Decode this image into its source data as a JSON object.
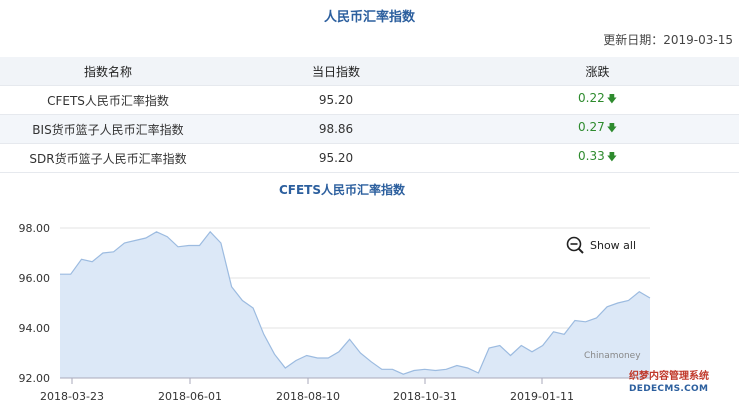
{
  "header": {
    "title": "人民币汇率指数",
    "update_label": "更新日期：",
    "update_date": "2019-03-15"
  },
  "table": {
    "columns": [
      "指数名称",
      "当日指数",
      "涨跌"
    ],
    "rows": [
      {
        "name": "CFETS人民币汇率指数",
        "value": "95.20",
        "change": "0.22"
      },
      {
        "name": "BIS货币篮子人民币汇率指数",
        "value": "98.86",
        "change": "0.27"
      },
      {
        "name": "SDR货币篮子人民币汇率指数",
        "value": "95.20",
        "change": "0.33"
      }
    ],
    "down_color": "#2e8b2e"
  },
  "chart": {
    "show_all_label": "Show all",
    "credit": "Chinamoney"
  },
  "watermark": {
    "line1": "织梦内容管理系统",
    "line2": "DEDECMS.COM"
  },
  "chart_data": {
    "type": "area",
    "title": "CFETS人民币汇率指数",
    "xlabel": "",
    "ylabel": "",
    "ylim": [
      92,
      98
    ],
    "yticks": [
      "98.00",
      "96.00",
      "94.00",
      "92.00"
    ],
    "xticks": [
      "2018-03-23",
      "2018-06-01",
      "2018-08-10",
      "2018-10-31",
      "2019-01-11"
    ],
    "grid": true,
    "fill_color": "#dce8f7",
    "line_color": "#9cbbe0",
    "values": [
      96.15,
      96.15,
      96.75,
      96.65,
      97.0,
      97.05,
      97.4,
      97.5,
      97.6,
      97.85,
      97.65,
      97.25,
      97.3,
      97.3,
      97.85,
      97.4,
      95.65,
      95.1,
      94.8,
      93.75,
      92.95,
      92.4,
      92.7,
      92.9,
      92.8,
      92.8,
      93.05,
      93.55,
      93.0,
      92.65,
      92.35,
      92.35,
      92.15,
      92.3,
      92.35,
      92.3,
      92.35,
      92.5,
      92.4,
      92.2,
      93.2,
      93.3,
      92.9,
      93.3,
      93.05,
      93.3,
      93.85,
      93.75,
      94.3,
      94.25,
      94.4,
      94.85,
      95.0,
      95.1,
      95.45,
      95.2
    ]
  }
}
